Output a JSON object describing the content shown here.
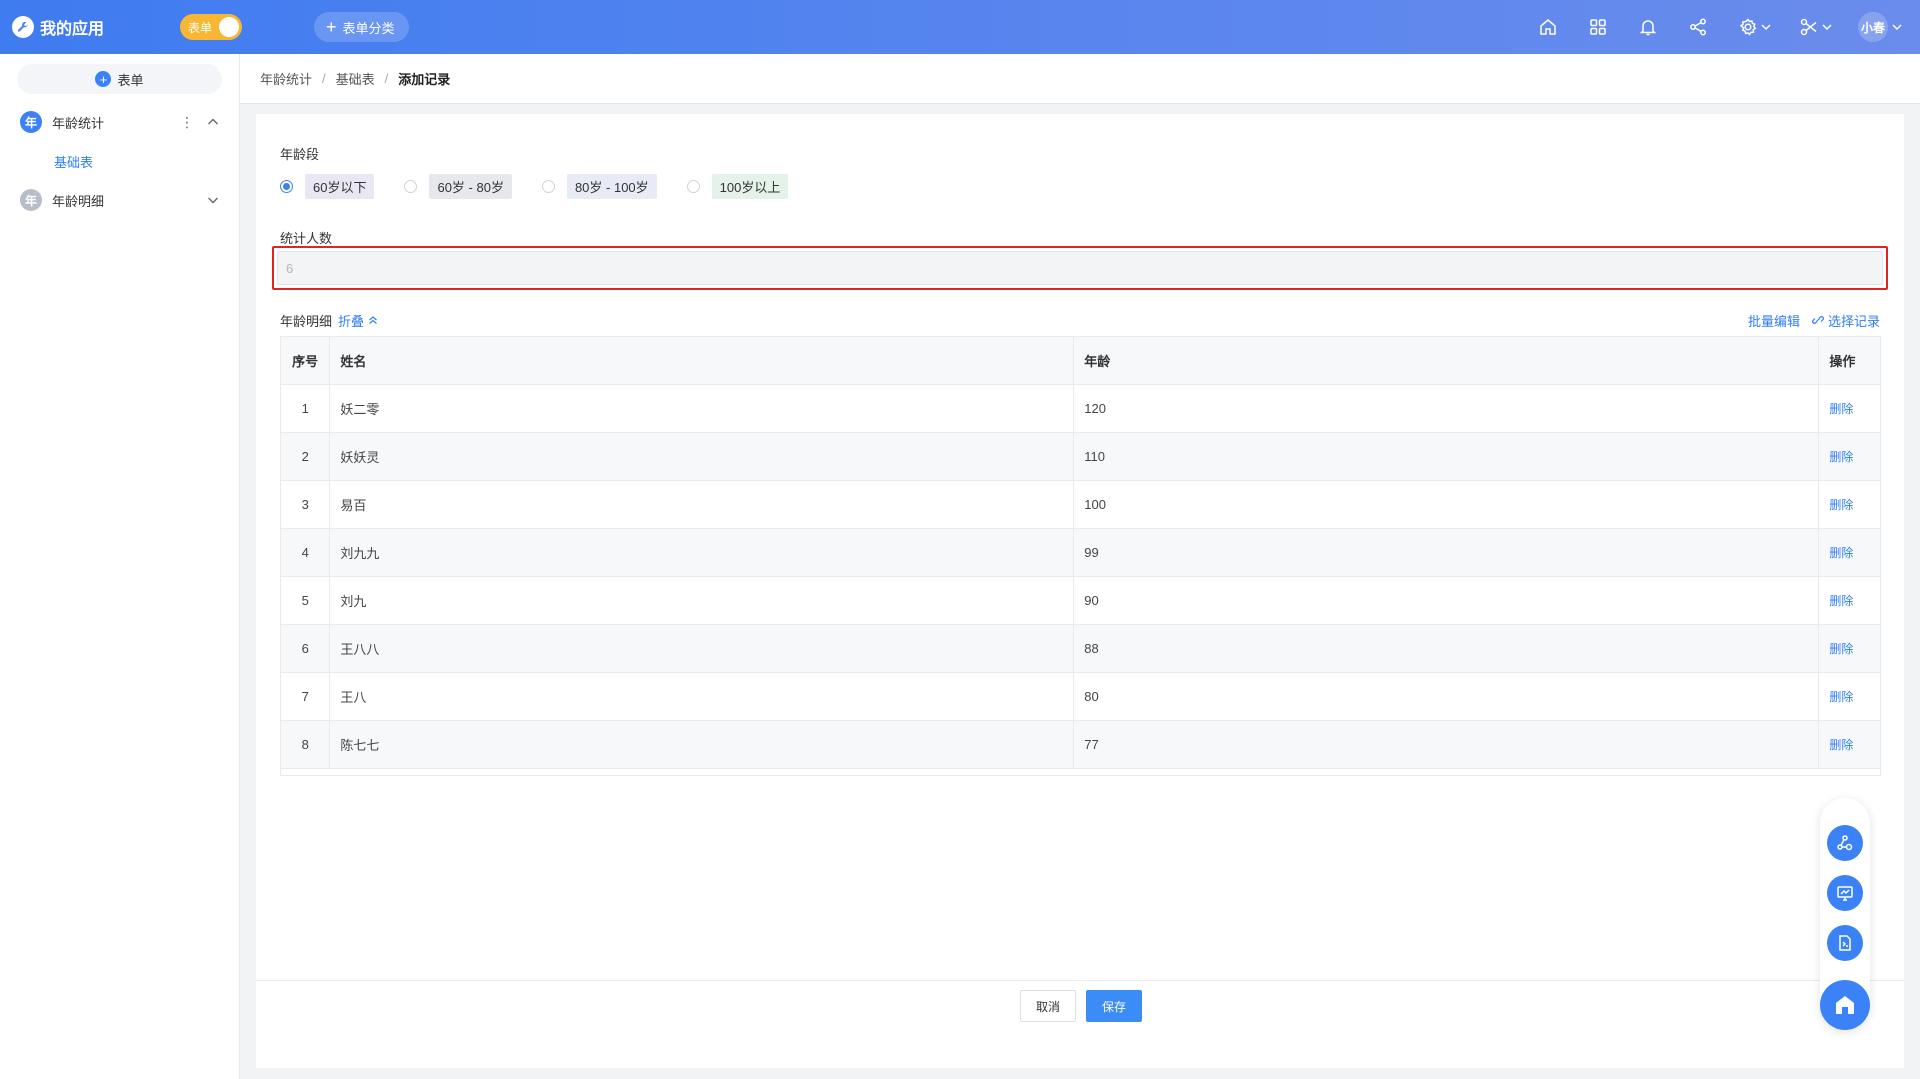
{
  "app": {
    "title": "我的应用",
    "mode_label": "表单",
    "add_category_label": "表单分类"
  },
  "header": {
    "user_name": "小春"
  },
  "sidebar": {
    "add_form_label": "表单",
    "groups": [
      {
        "badge": "年",
        "label": "年龄统计",
        "items": [
          {
            "label": "基础表"
          }
        ]
      },
      {
        "badge": "年",
        "label": "年龄明细",
        "items": []
      }
    ]
  },
  "breadcrumb": [
    "年龄统计",
    "基础表",
    "添加记录"
  ],
  "form": {
    "age_group": {
      "label": "年龄段",
      "options": [
        "60岁以下",
        "60岁 - 80岁",
        "80岁 - 100岁",
        "100岁以上"
      ],
      "selected": "60岁以下"
    },
    "count": {
      "label": "统计人数",
      "value": "6"
    },
    "detail": {
      "label": "年龄明细",
      "fold_label": "折叠",
      "batch_edit_label": "批量编辑",
      "select_record_label": "选择记录",
      "columns": [
        "序号",
        "姓名",
        "年龄",
        "操作"
      ],
      "delete_label": "删除",
      "rows": [
        {
          "index": "1",
          "name": "妖二零",
          "age": "120"
        },
        {
          "index": "2",
          "name": "妖妖灵",
          "age": "110"
        },
        {
          "index": "3",
          "name": "易百",
          "age": "100"
        },
        {
          "index": "4",
          "name": "刘九九",
          "age": "99"
        },
        {
          "index": "5",
          "name": "刘九",
          "age": "90"
        },
        {
          "index": "6",
          "name": "王八八",
          "age": "88"
        },
        {
          "index": "7",
          "name": "王八",
          "age": "80"
        },
        {
          "index": "8",
          "name": "陈七七",
          "age": "77"
        }
      ]
    },
    "cancel_label": "取消",
    "save_label": "保存"
  },
  "colors": {
    "topbar": "#4a7ff0",
    "accent": "#3b82f6",
    "highlight_border": "#e02424",
    "toggle": "#f7b733"
  }
}
